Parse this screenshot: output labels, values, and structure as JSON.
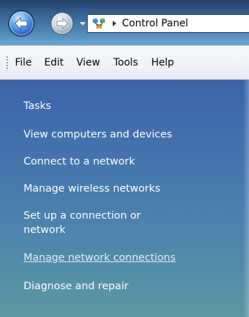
{
  "address_bar": {
    "breadcrumb": "Control Panel",
    "location_icon": "control-panel-icon"
  },
  "menu": {
    "items": [
      {
        "label": "File"
      },
      {
        "label": "Edit"
      },
      {
        "label": "View"
      },
      {
        "label": "Tools"
      },
      {
        "label": "Help"
      }
    ]
  },
  "tasks": {
    "heading": "Tasks",
    "items": [
      {
        "label": "View computers and devices"
      },
      {
        "label": "Connect to a network"
      },
      {
        "label": "Manage wireless networks"
      },
      {
        "label_line1": "Set up a connection or",
        "label_line2": "network"
      },
      {
        "label": "Manage network connections",
        "state": "hovered"
      },
      {
        "label": "Diagnose and repair"
      }
    ]
  }
}
